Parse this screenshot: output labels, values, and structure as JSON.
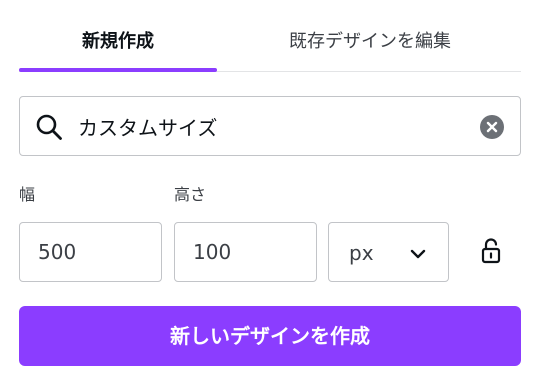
{
  "tabs": {
    "new_label": "新規作成",
    "edit_label": "既存デザインを編集",
    "active": "new"
  },
  "search": {
    "value": "カスタムサイズ",
    "placeholder": "カスタムサイズ",
    "icon": "search-icon",
    "clear_icon": "clear-icon"
  },
  "size": {
    "width_label": "幅",
    "height_label": "高さ",
    "width_value": "500",
    "height_value": "100",
    "unit": "px",
    "unit_icon": "chevron-down-icon",
    "lock_icon": "unlocked-icon"
  },
  "create": {
    "label": "新しいデザインを作成"
  },
  "colors": {
    "accent": "#8b3dff",
    "text": "#0e1318",
    "border": "#c2c4c8"
  }
}
